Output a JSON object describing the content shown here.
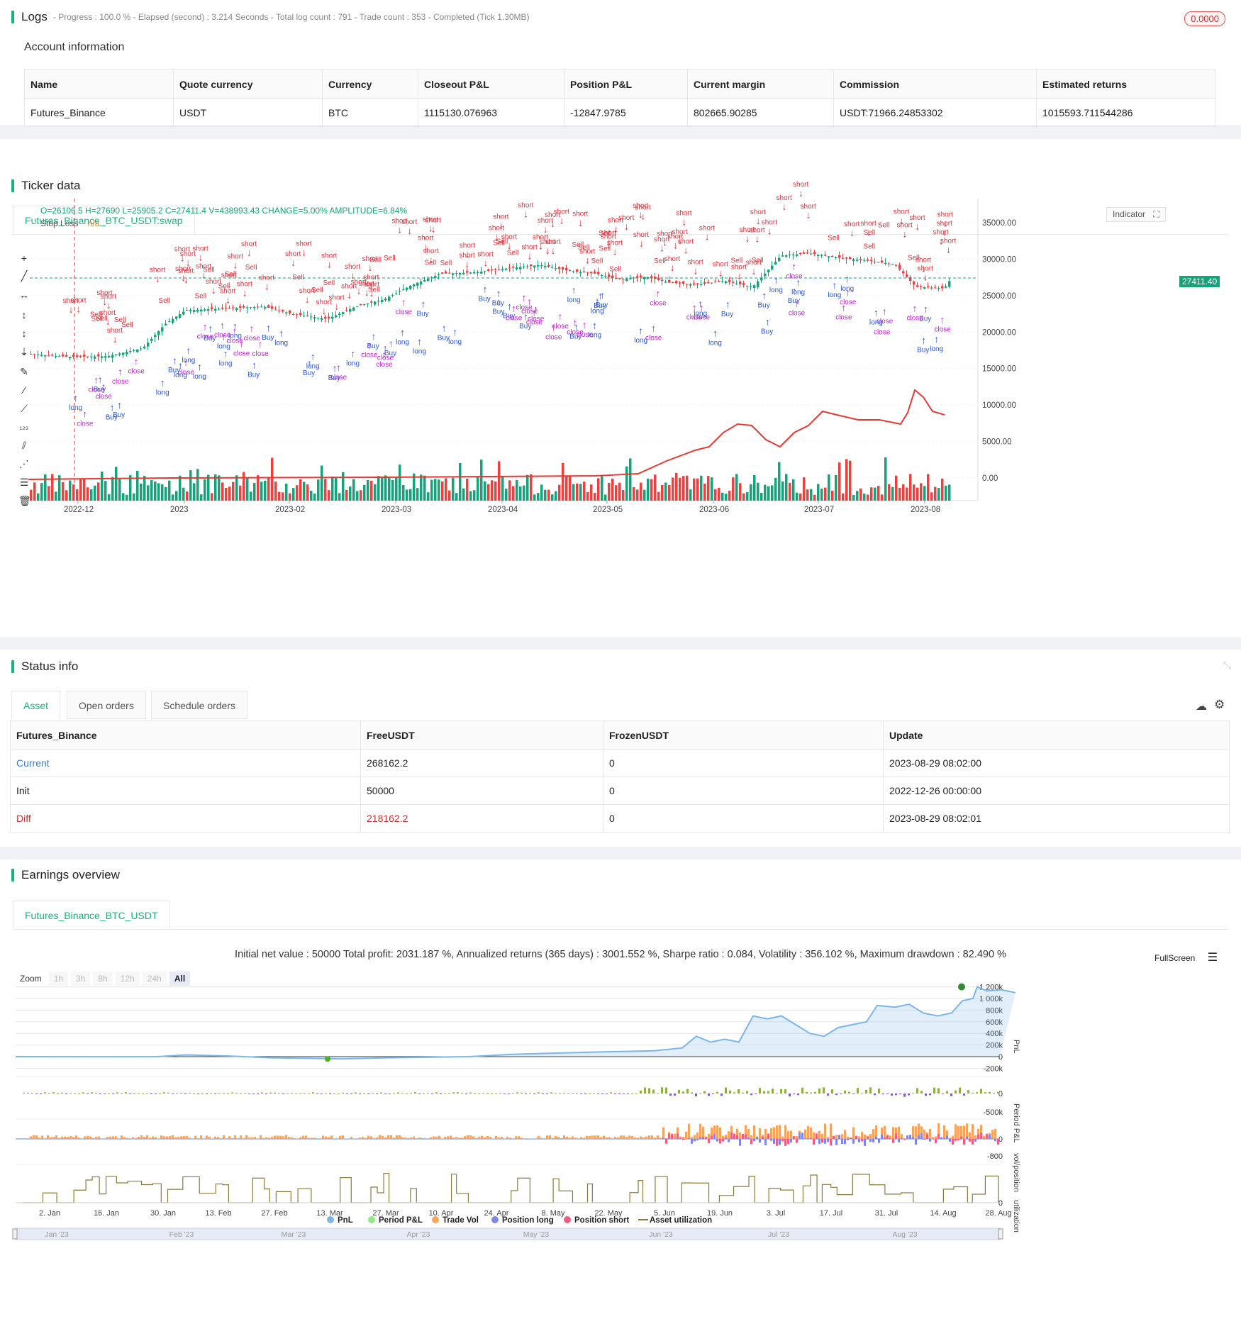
{
  "logs": {
    "title": "Logs",
    "status": "- Progress : 100.0 % - Elapsed (second) : 3.214 Seconds - Total log count : 791 - Trade count : 353 - Completed (Tick 1.30MB)",
    "badge": "0.0000"
  },
  "account": {
    "title": "Account information",
    "headers": [
      "Name",
      "Quote currency",
      "Currency",
      "Closeout P&L",
      "Position P&L",
      "Current margin",
      "Commission",
      "Estimated returns"
    ],
    "row": [
      "Futures_Binance",
      "USDT",
      "BTC",
      "1115130.076963",
      "-12847.9785",
      "802665.90285",
      "USDT:71966.24853302",
      "1015593.711544286"
    ]
  },
  "ticker": {
    "title": "Ticker data",
    "tab": "Futures_Binance_BTC_USDT:swap",
    "ohlc": "O=26106.5 H=27690 L=25905.2 C=27411.4 V=438993.43 CHANGE=5.00% AMPLITUDE=6.84%",
    "stop_loss_label": "Stop Loss",
    "stop_loss_value": "n/a",
    "indicator_btn": "Indicator",
    "last_price": "27411.40",
    "y_ticks": [
      "35000.00",
      "30000.00",
      "25000.00",
      "20000.00",
      "15000.00",
      "10000.00",
      "5000.00",
      "0.00"
    ],
    "x_ticks": [
      "2022-12",
      "2023",
      "2023-02",
      "2023-03",
      "2023-04",
      "2023-05",
      "2023-06",
      "2023-07",
      "2023-08"
    ],
    "marker_words": {
      "short": "short",
      "close": "close",
      "buy": "Buy",
      "long": "long",
      "sell": "Sell"
    },
    "colors": {
      "up": "#14a37a",
      "down": "#ef4040",
      "short": "#e0303a",
      "long": "#2a56e0",
      "close": "#c020d0"
    }
  },
  "status": {
    "title": "Status info",
    "tabs": [
      "Asset",
      "Open orders",
      "Schedule orders"
    ],
    "headers": [
      "Futures_Binance",
      "FreeUSDT",
      "FrozenUSDT",
      "Update"
    ],
    "rows": [
      [
        "Current",
        "268162.2",
        "0",
        "2023-08-29 08:02:00"
      ],
      [
        "Init",
        "50000",
        "0",
        "2022-12-26 00:00:00"
      ],
      [
        "Diff",
        "218162.2",
        "0",
        "2023-08-29 08:02:01"
      ]
    ]
  },
  "earnings": {
    "title": "Earnings overview",
    "tab": "Futures_Binance_BTC_USDT",
    "summary": "Initial net value : 50000 Total profit: 2031.187 %, Annualized returns (365 days) : 3001.552 %, Sharpe ratio : 0.084, Volatility : 356.102 %, Maximum drawdown : 82.490 %",
    "fullscreen": "FullScreen",
    "zoom_label": "Zoom",
    "zoom_options": [
      "1h",
      "3h",
      "8h",
      "12h",
      "24h",
      "All"
    ],
    "pnl_ticks": [
      "1 200k",
      "1 000k",
      "800k",
      "600k",
      "400k",
      "200k",
      "0",
      "-200k"
    ],
    "period_ticks": [
      "0",
      "-500k"
    ],
    "vol_ticks": [
      "0",
      "-800"
    ],
    "util_ticks": [
      "0"
    ],
    "axis_titles": [
      "PnL",
      "Period P&L",
      "vol/position",
      "utilization"
    ],
    "x_ticks": [
      "2. Jan",
      "16. Jan",
      "30. Jan",
      "13. Feb",
      "27. Feb",
      "13. Mar",
      "27. Mar",
      "10. Apr",
      "24. Apr",
      "8. May",
      "22. May",
      "5. Jun",
      "19. Jun",
      "3. Jul",
      "17. Jul",
      "31. Jul",
      "14. Aug",
      "28. Aug"
    ],
    "legend": [
      {
        "label": "PnL",
        "color": "#7cb5ec"
      },
      {
        "label": "Period P&L",
        "color": "#90ed7d"
      },
      {
        "label": "Trade Vol",
        "color": "#f7a35c"
      },
      {
        "label": "Position long",
        "color": "#8085e9"
      },
      {
        "label": "Position short",
        "color": "#f15c80"
      },
      {
        "label": "Asset utilization",
        "color": "#8d7a3a"
      }
    ],
    "navigator_ticks": [
      "Jan '23",
      "Feb '23",
      "Mar '23",
      "Apr '23",
      "May '23",
      "Jun '23",
      "Jul '23",
      "Aug '23"
    ]
  }
}
